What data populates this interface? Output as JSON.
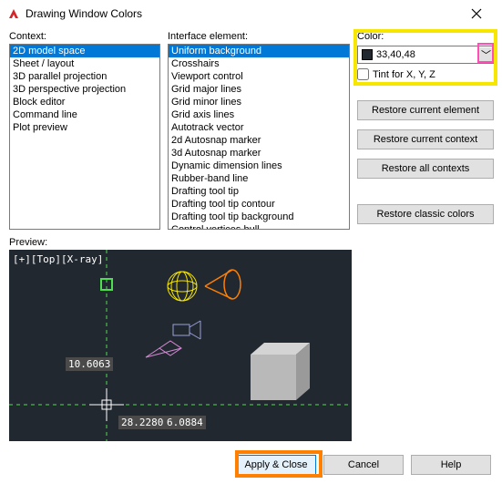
{
  "title": "Drawing Window Colors",
  "labels": {
    "context": "Context:",
    "iface": "Interface element:",
    "color": "Color:",
    "tint": "Tint for X, Y, Z",
    "preview": "Preview:"
  },
  "context_items": [
    "2D model space",
    "Sheet / layout",
    "3D parallel projection",
    "3D perspective projection",
    "Block editor",
    "Command line",
    "Plot preview"
  ],
  "context_selected": 0,
  "iface_items": [
    "Uniform background",
    "Crosshairs",
    "Viewport control",
    "Grid major lines",
    "Grid minor lines",
    "Grid axis lines",
    "Autotrack vector",
    "2d Autosnap marker",
    "3d Autosnap marker",
    "Dynamic dimension lines",
    "Rubber-band line",
    "Drafting tool tip",
    "Drafting tool tip contour",
    "Drafting tool tip background",
    "Control vertices hull"
  ],
  "iface_selected": 0,
  "color_value": "33,40,48",
  "buttons": {
    "restore_element": "Restore current element",
    "restore_context": "Restore current context",
    "restore_all": "Restore all contexts",
    "restore_classic": "Restore classic colors",
    "apply": "Apply & Close",
    "cancel": "Cancel",
    "help": "Help"
  },
  "preview": {
    "viewlabel": "[+][Top][X-ray]",
    "dim1": "10.6063",
    "dim2": "28.2280",
    "dim3": "6.0884"
  }
}
